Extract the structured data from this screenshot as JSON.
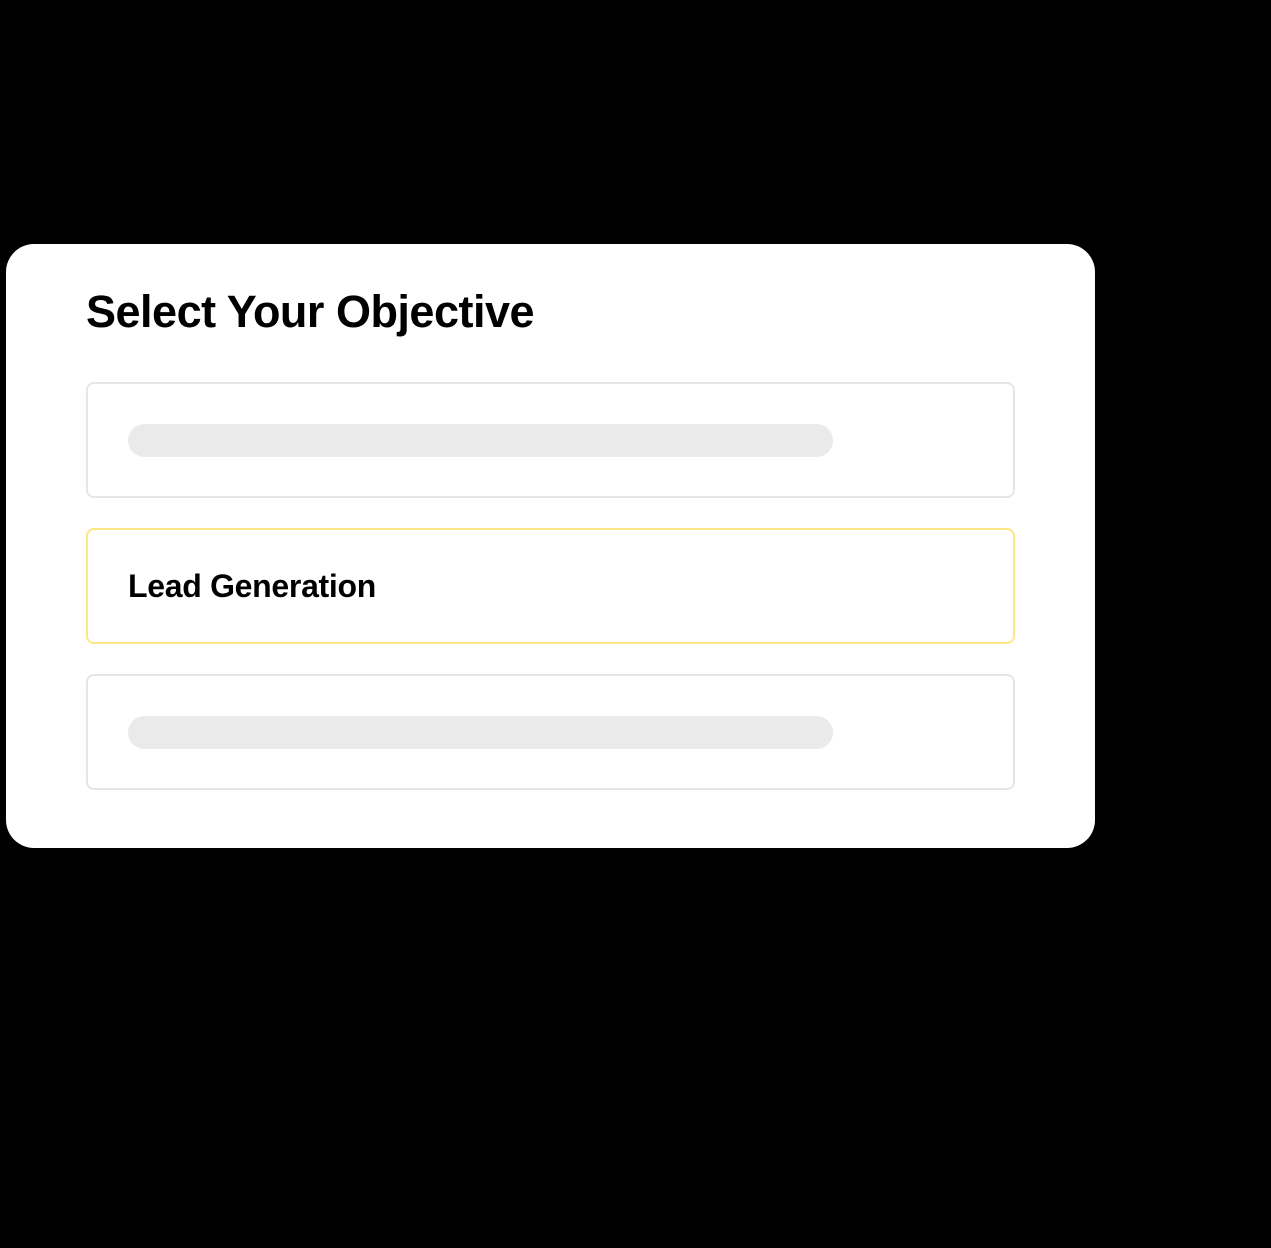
{
  "card": {
    "title": "Select Your Objective",
    "options": {
      "selected_label": "Lead Generation"
    },
    "colors": {
      "highlight_border": "#ffe680",
      "placeholder": "#eaeaea",
      "default_border": "#e5e5e5"
    }
  }
}
